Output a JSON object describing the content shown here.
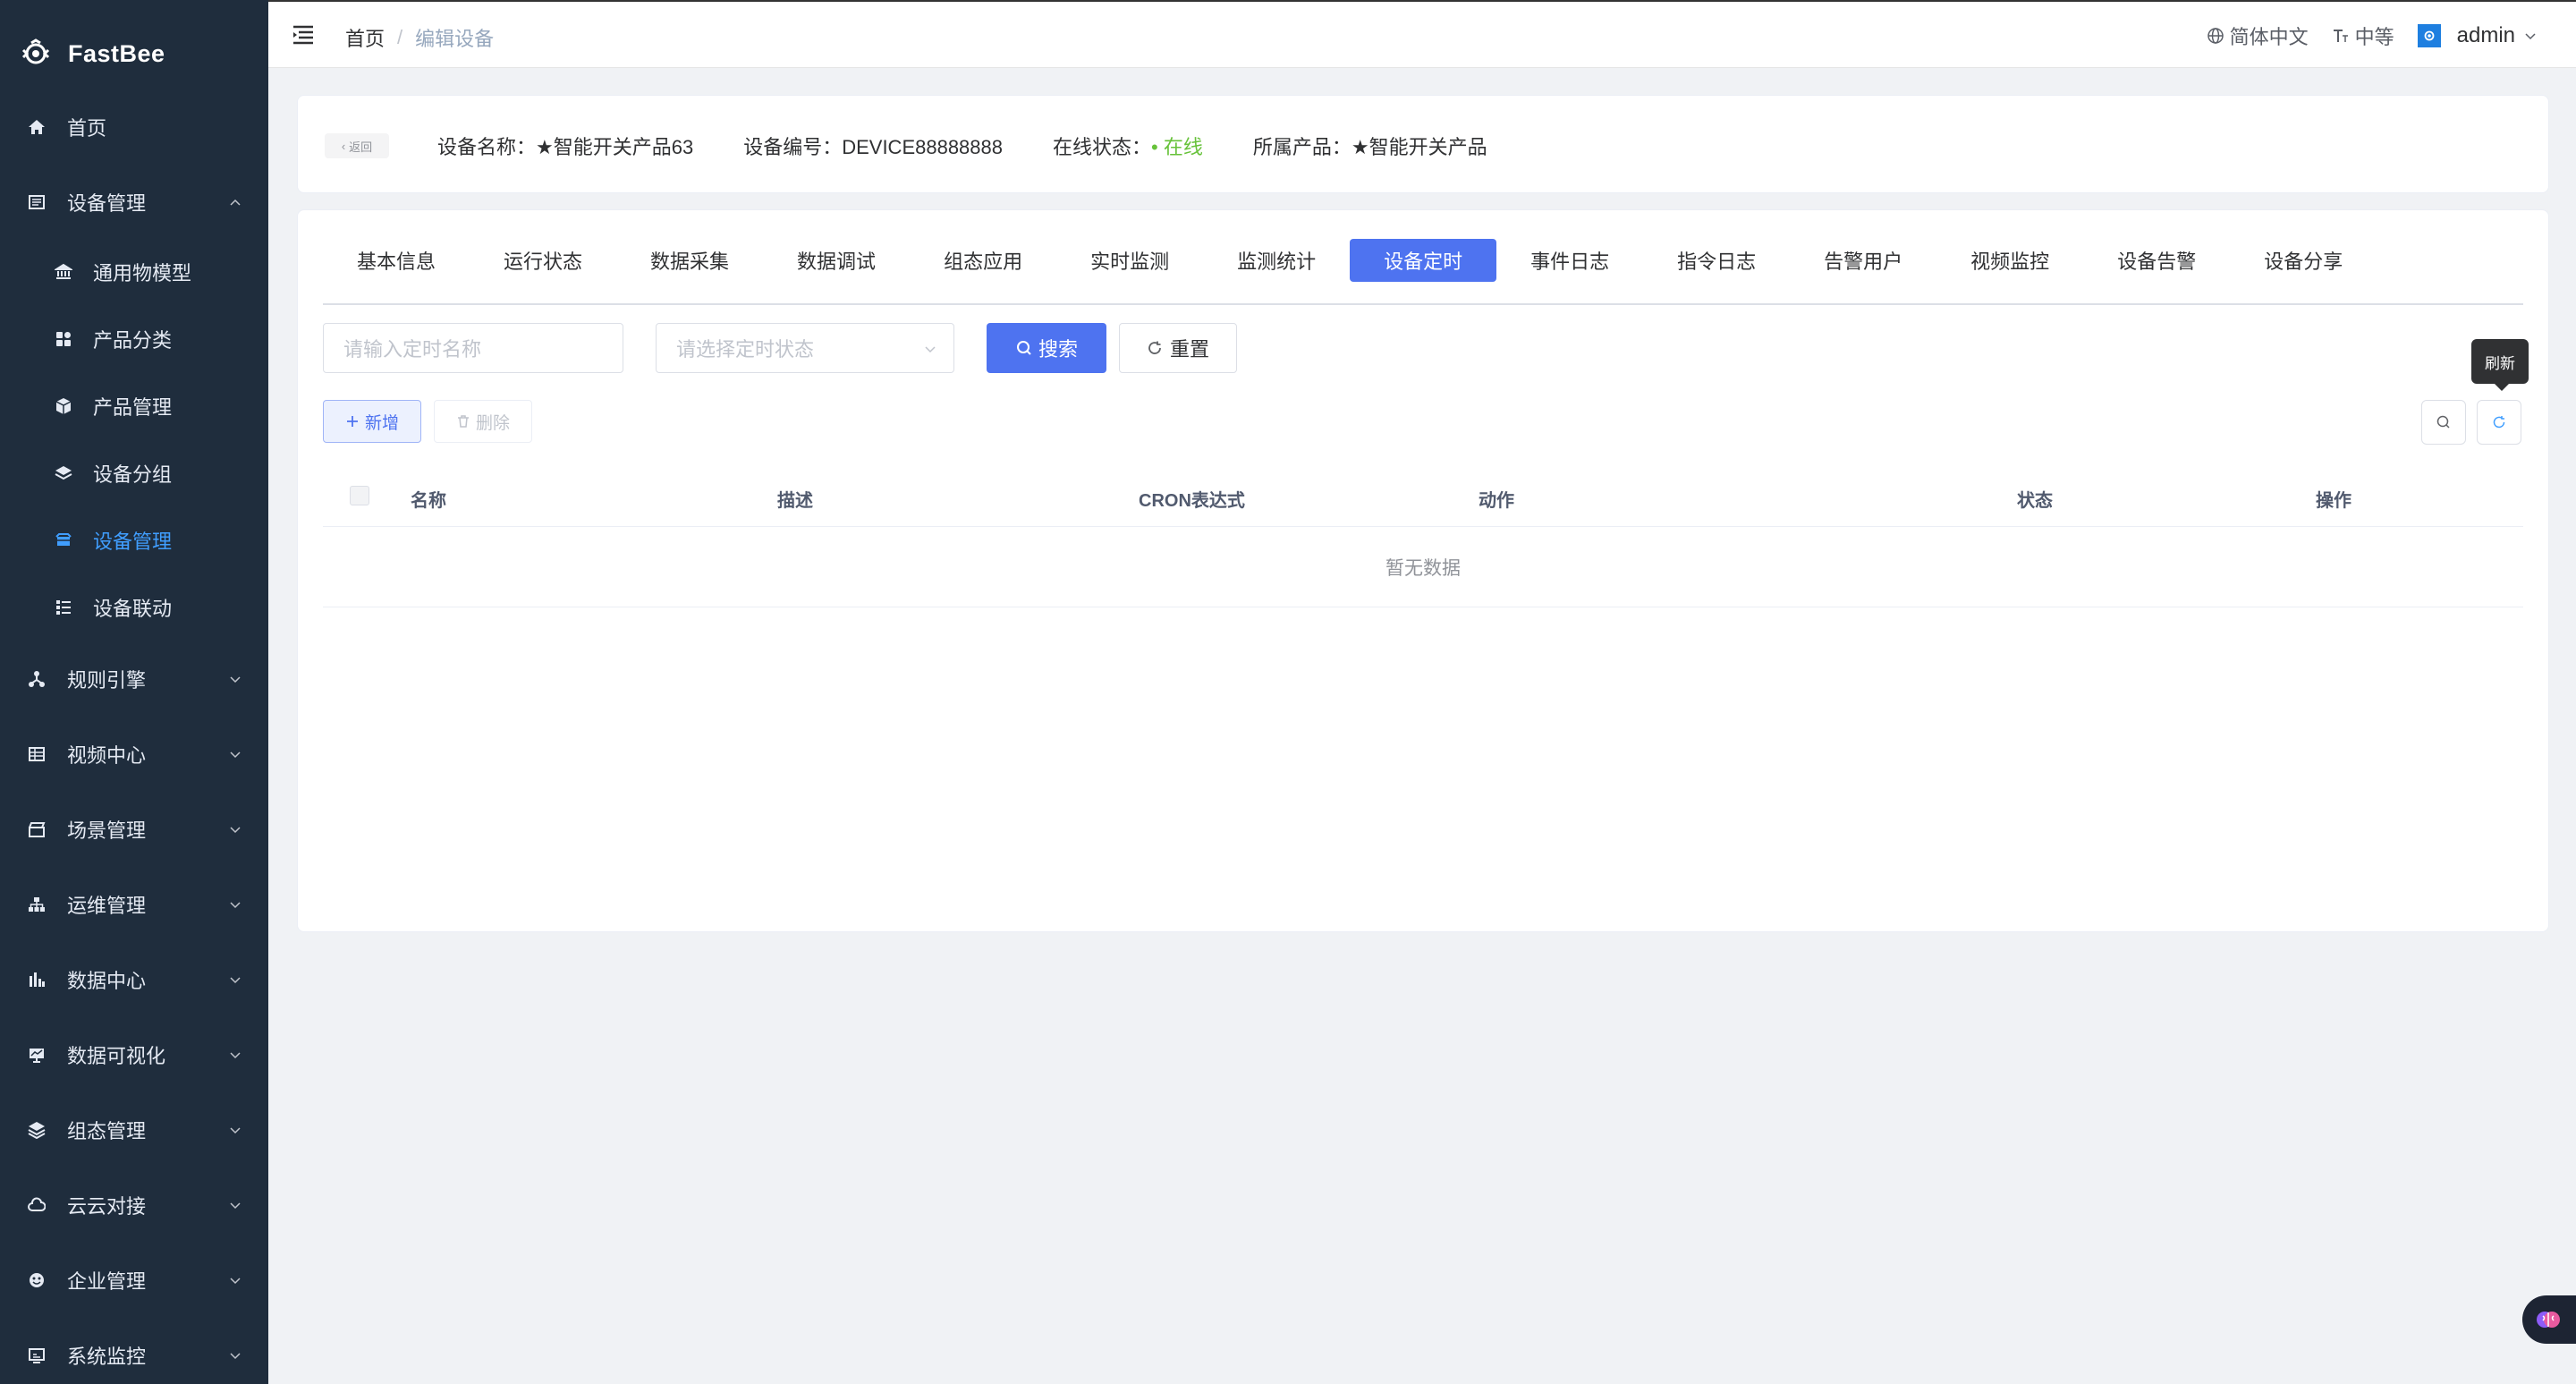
{
  "app": {
    "name": "FastBee"
  },
  "sidebar": {
    "items": [
      {
        "label": "首页",
        "icon": "home-icon"
      },
      {
        "label": "设备管理",
        "icon": "device-list-icon",
        "expanded": true,
        "children": [
          {
            "label": "通用物模型",
            "icon": "bank-icon"
          },
          {
            "label": "产品分类",
            "icon": "category-icon"
          },
          {
            "label": "产品管理",
            "icon": "cube-icon"
          },
          {
            "label": "设备分组",
            "icon": "layers-icon"
          },
          {
            "label": "设备管理",
            "icon": "box-icon",
            "active": true
          },
          {
            "label": "设备联动",
            "icon": "linkage-icon"
          }
        ]
      },
      {
        "label": "规则引擎",
        "icon": "share-icon"
      },
      {
        "label": "视频中心",
        "icon": "grid-icon"
      },
      {
        "label": "场景管理",
        "icon": "clapper-icon"
      },
      {
        "label": "运维管理",
        "icon": "tree-icon"
      },
      {
        "label": "数据中心",
        "icon": "bar-chart-icon"
      },
      {
        "label": "数据可视化",
        "icon": "monitor-icon"
      },
      {
        "label": "组态管理",
        "icon": "stack-icon"
      },
      {
        "label": "云云对接",
        "icon": "cloud-icon"
      },
      {
        "label": "企业管理",
        "icon": "enterprise-icon"
      },
      {
        "label": "系统监控",
        "icon": "screen-icon"
      }
    ]
  },
  "header": {
    "breadcrumb": {
      "home": "首页",
      "separator": "/",
      "current": "编辑设备"
    },
    "language": "简体中文",
    "font_size": "中等",
    "user": "admin"
  },
  "device_info": {
    "back_label": "返回",
    "name": "设备名称：★智能开关产品63",
    "serial": "设备编号：DEVICE88888888",
    "status_label": "在线状态：",
    "status_value": "• 在线",
    "product": "所属产品：★智能开关产品"
  },
  "tabs": [
    {
      "label": "基本信息"
    },
    {
      "label": "运行状态"
    },
    {
      "label": "数据采集"
    },
    {
      "label": "数据调试"
    },
    {
      "label": "组态应用"
    },
    {
      "label": "实时监测"
    },
    {
      "label": "监测统计"
    },
    {
      "label": "设备定时",
      "active": true
    },
    {
      "label": "事件日志"
    },
    {
      "label": "指令日志"
    },
    {
      "label": "告警用户"
    },
    {
      "label": "视频监控"
    },
    {
      "label": "设备告警"
    },
    {
      "label": "设备分享"
    }
  ],
  "query": {
    "name_placeholder": "请输入定时名称",
    "status_placeholder": "请选择定时状态",
    "search_label": "搜索",
    "reset_label": "重置"
  },
  "toolbar": {
    "add_label": "新增",
    "delete_label": "删除",
    "refresh_tooltip": "刷新"
  },
  "table": {
    "columns": [
      "名称",
      "描述",
      "CRON表达式",
      "动作",
      "状态",
      "操作"
    ],
    "empty_text": "暂无数据"
  },
  "colors": {
    "sidebar_bg": "#1f2d3d",
    "primary": "#4e73f0",
    "active_menu": "#409eff",
    "online": "#67c23a"
  }
}
